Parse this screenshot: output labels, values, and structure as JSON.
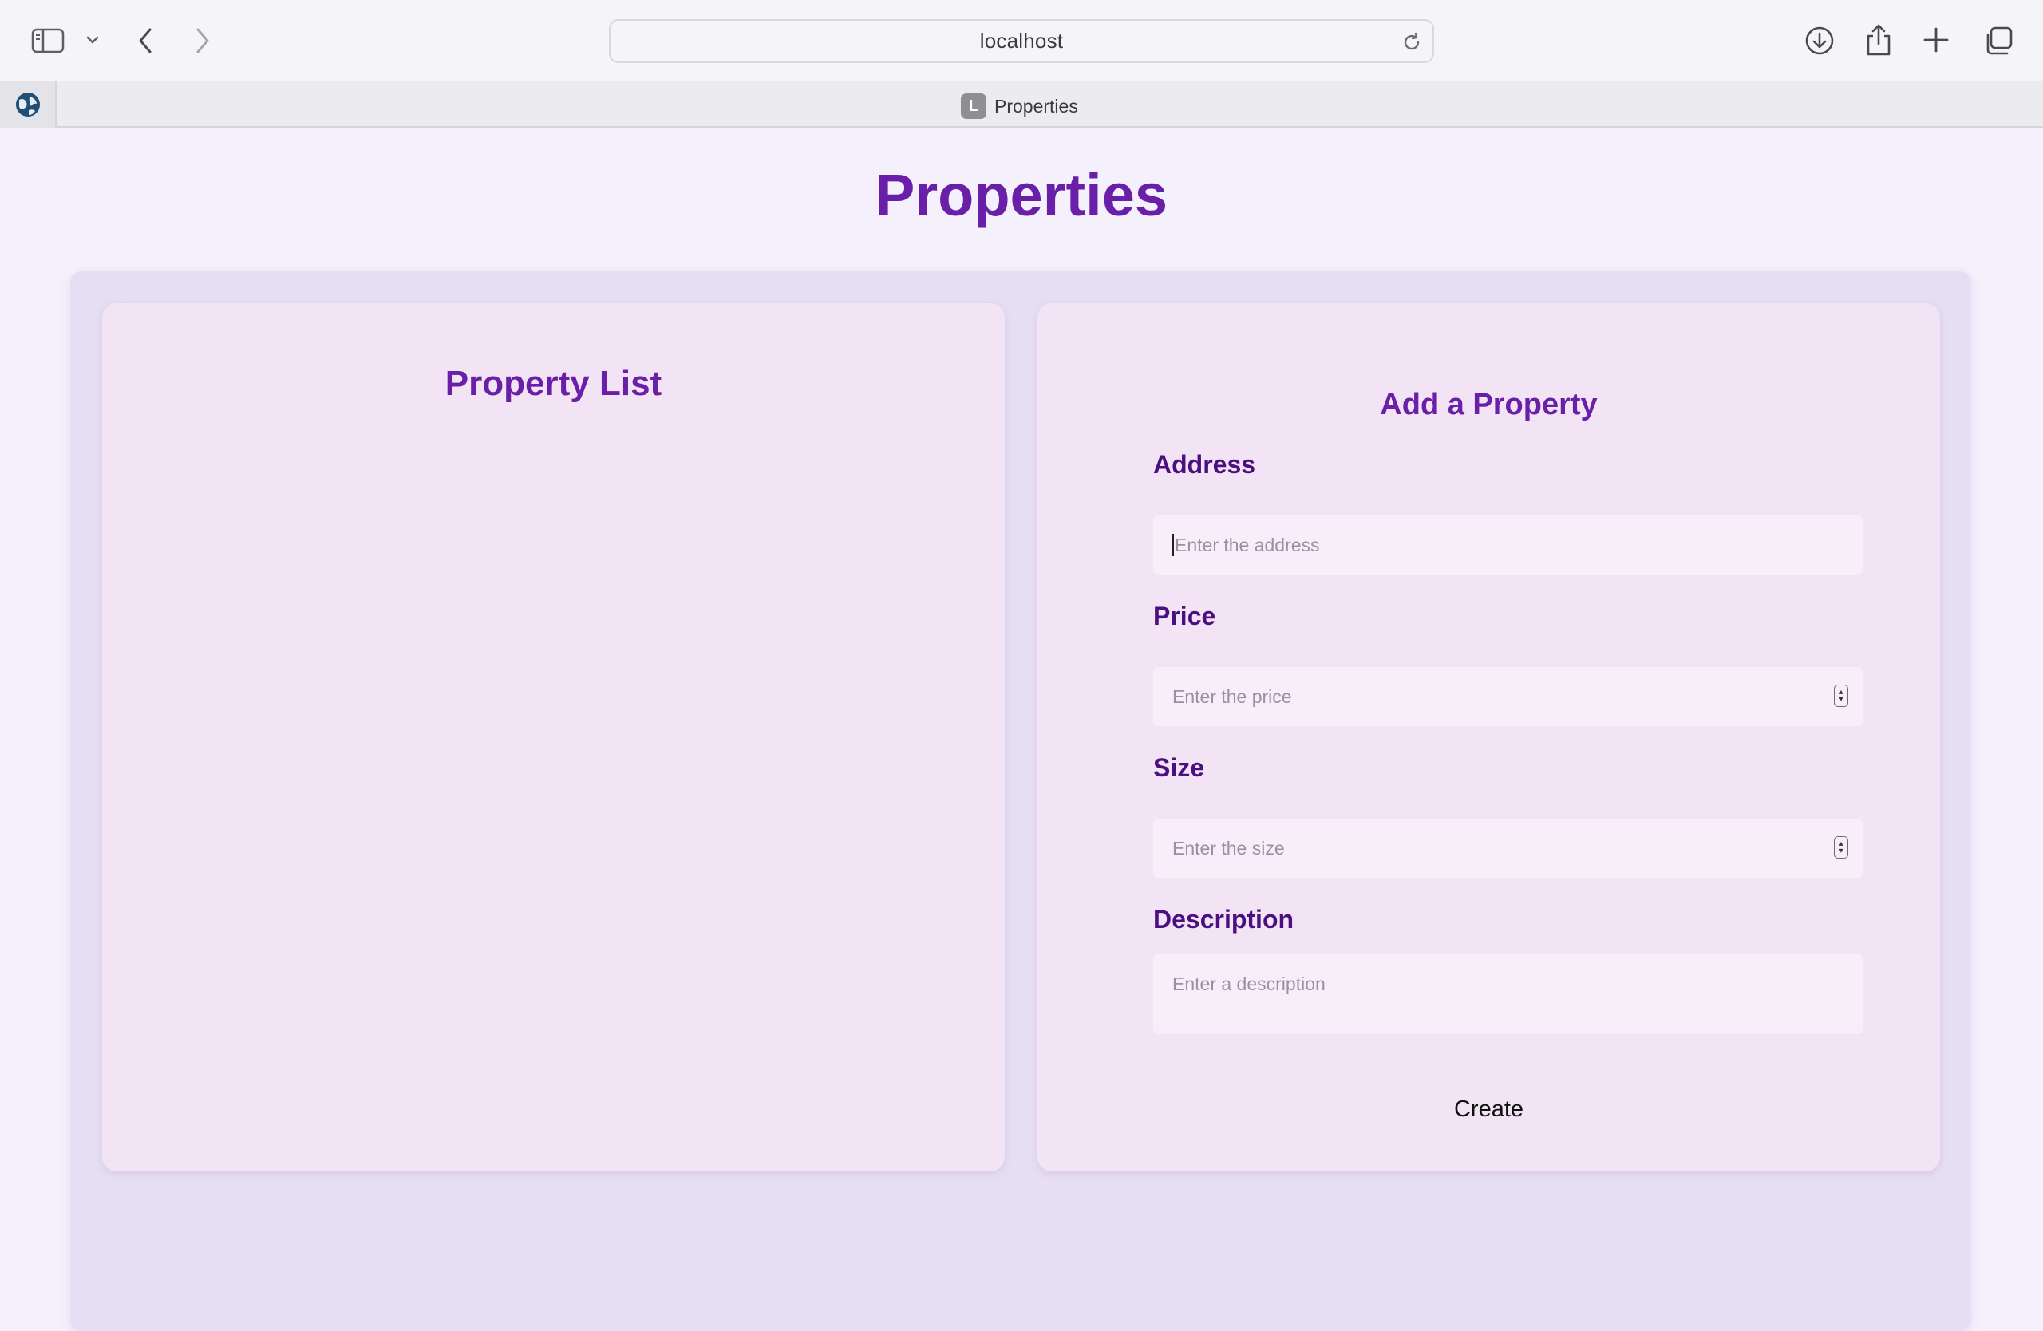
{
  "browser": {
    "url": "localhost",
    "tab_title": "Properties",
    "tab_favicon_letter": "L"
  },
  "page": {
    "title": "Properties",
    "property_list": {
      "heading": "Property List",
      "items": []
    },
    "form": {
      "heading": "Add a Property",
      "fields": {
        "address": {
          "label": "Address",
          "placeholder": "Enter the address",
          "value": ""
        },
        "price": {
          "label": "Price",
          "placeholder": "Enter the price",
          "value": ""
        },
        "size": {
          "label": "Size",
          "placeholder": "Enter the size",
          "value": ""
        },
        "description": {
          "label": "Description",
          "placeholder": "Enter a description",
          "value": ""
        }
      },
      "submit_label": "Create"
    }
  },
  "colors": {
    "accent": "#6a1fa8",
    "label": "#4a0f80",
    "background": "#f4f0fc",
    "card": "#f2e4f4",
    "input": "#f8eefa"
  }
}
